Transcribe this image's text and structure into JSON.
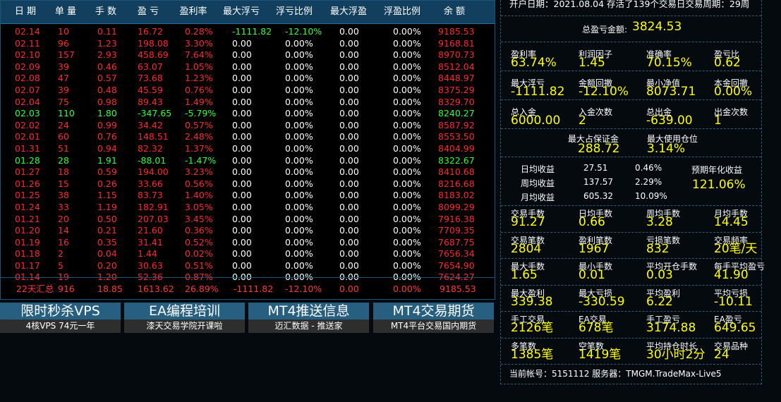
{
  "table": {
    "headers": [
      "日 期",
      "单 量",
      "手 数",
      "盈 亏",
      "盈利率",
      "最大浮亏",
      "浮亏比例",
      "最大浮盈",
      "浮盈比例",
      "余 额"
    ],
    "rows": [
      [
        "02.14",
        "10",
        "0.11",
        "16.72",
        "0.28%",
        "-1111.82",
        "-12.10%",
        "0.00",
        "0.00%",
        "9185.53"
      ],
      [
        "02.11",
        "96",
        "1.23",
        "198.08",
        "3.30%",
        "0.00",
        "0.00%",
        "0.00",
        "0.00%",
        "9168.81"
      ],
      [
        "02.10",
        "157",
        "2.93",
        "458.69",
        "7.64%",
        "0.00",
        "0.00%",
        "0.00",
        "0.00%",
        "8970.73"
      ],
      [
        "02.09",
        "39",
        "0.46",
        "63.07",
        "1.05%",
        "0.00",
        "0.00%",
        "0.00",
        "0.00%",
        "8512.04"
      ],
      [
        "02.08",
        "47",
        "0.57",
        "73.68",
        "1.23%",
        "0.00",
        "0.00%",
        "0.00",
        "0.00%",
        "8448.97"
      ],
      [
        "02.07",
        "39",
        "0.48",
        "45.59",
        "0.76%",
        "0.00",
        "0.00%",
        "0.00",
        "0.00%",
        "8375.29"
      ],
      [
        "02.04",
        "75",
        "0.98",
        "89.43",
        "1.49%",
        "0.00",
        "0.00%",
        "0.00",
        "0.00%",
        "8329.70"
      ],
      [
        "02.03",
        "110",
        "1.80",
        "-347.65",
        "-5.79%",
        "0.00",
        "0.00%",
        "0.00",
        "0.00%",
        "8240.27"
      ],
      [
        "02.02",
        "24",
        "0.99",
        "34.42",
        "0.57%",
        "0.00",
        "0.00%",
        "0.00",
        "0.00%",
        "8587.92"
      ],
      [
        "02.01",
        "60",
        "0.76",
        "148.51",
        "2.48%",
        "0.00",
        "0.00%",
        "0.00",
        "0.00%",
        "8553.50"
      ],
      [
        "01.31",
        "51",
        "0.94",
        "82.32",
        "1.37%",
        "0.00",
        "0.00%",
        "0.00",
        "0.00%",
        "8404.99"
      ],
      [
        "01.28",
        "28",
        "1.91",
        "-88.01",
        "-1.47%",
        "0.00",
        "0.00%",
        "0.00",
        "0.00%",
        "8322.67"
      ],
      [
        "01.27",
        "18",
        "0.59",
        "194.00",
        "3.23%",
        "0.00",
        "0.00%",
        "0.00",
        "0.00%",
        "8410.68"
      ],
      [
        "01.26",
        "15",
        "0.26",
        "33.66",
        "0.56%",
        "0.00",
        "0.00%",
        "0.00",
        "0.00%",
        "8216.68"
      ],
      [
        "01.25",
        "38",
        "1.15",
        "83.73",
        "1.40%",
        "0.00",
        "0.00%",
        "0.00",
        "0.00%",
        "8183.02"
      ],
      [
        "01.24",
        "33",
        "1.19",
        "182.91",
        "3.05%",
        "0.00",
        "0.00%",
        "0.00",
        "0.00%",
        "8099.29"
      ],
      [
        "01.21",
        "20",
        "0.50",
        "207.03",
        "3.45%",
        "0.00",
        "0.00%",
        "0.00",
        "0.00%",
        "7916.38"
      ],
      [
        "01.20",
        "14",
        "0.21",
        "21.60",
        "0.36%",
        "0.00",
        "0.00%",
        "0.00",
        "0.00%",
        "7709.35"
      ],
      [
        "01.19",
        "16",
        "0.35",
        "31.41",
        "0.52%",
        "0.00",
        "0.00%",
        "0.00",
        "0.00%",
        "7687.75"
      ],
      [
        "01.18",
        "2",
        "0.04",
        "1.44",
        "0.02%",
        "0.00",
        "0.00%",
        "0.00",
        "0.00%",
        "7656.34"
      ],
      [
        "01.17",
        "5",
        "0.20",
        "30.63",
        "0.51%",
        "0.00",
        "0.00%",
        "0.00",
        "0.00%",
        "7654.90"
      ],
      [
        "01.14",
        "19",
        "1.20",
        "52.36",
        "0.87%",
        "0.00",
        "0.00%",
        "0.00",
        "0.00%",
        "7624.27"
      ]
    ],
    "total": [
      "22天汇总",
      "916",
      "18.85",
      "1613.62",
      "26.89%",
      "-1111.82",
      "-12.10%",
      "0.00",
      "0.00%",
      "9185.53"
    ]
  },
  "colors": {
    "loss_row": "#33ff33",
    "profit_row": "#ff2a2a",
    "neutral": "#ffffff",
    "value": "#ffff00",
    "header_bg": "#123f5e"
  },
  "ads": [
    {
      "title": "限时秒杀VPS",
      "sub": "4核VPS  74元一年"
    },
    {
      "title": "EA编程培训",
      "sub": "漆天交易学院开课啦"
    },
    {
      "title": "MT4推送信息",
      "sub": "迈汇数据 - 推送家"
    },
    {
      "title": "MT4交易期货",
      "sub": "MT4平台交易国内期货"
    }
  ],
  "summary": {
    "open_info": "开户日期：2021.08.04 存活了139个交易日交易周期：29周",
    "total_profit_label": "总盈亏金额:",
    "total_profit": "3824.53",
    "grid1": [
      {
        "label": "盈利率",
        "value": "63.74%"
      },
      {
        "label": "利润因子",
        "value": "1.45"
      },
      {
        "label": "准确率",
        "value": "70.15%"
      },
      {
        "label": "盈亏比",
        "value": "0.62"
      },
      {
        "label": "最大浮亏",
        "value": "-1111.82"
      },
      {
        "label": "金额回撤",
        "value": "-12.10%"
      },
      {
        "label": "最小净值",
        "value": "8073.71"
      },
      {
        "label": "本金回撤",
        "value": "0.00%"
      },
      {
        "label": "总入金",
        "value": "6000.00"
      },
      {
        "label": "入金次数",
        "value": "2"
      },
      {
        "label": "总出金",
        "value": "-639.00"
      },
      {
        "label": "出金次数",
        "value": "1"
      }
    ],
    "margin": [
      {
        "label": "最大占保证金",
        "value": "288.72"
      },
      {
        "label": "最大使用仓位",
        "value": "3.14%"
      }
    ],
    "returns": [
      {
        "label": "日均收益",
        "amount": "27.51",
        "pct": "0.46%"
      },
      {
        "label": "周均收益",
        "amount": "137.57",
        "pct": "2.29%"
      },
      {
        "label": "月均收益",
        "amount": "605.32",
        "pct": "10.09%"
      }
    ],
    "annual_label": "预期年化收益",
    "annual_value": "121.06%",
    "grid2": [
      {
        "label": "交易手数",
        "value": "91.27"
      },
      {
        "label": "日均手数",
        "value": "0.66"
      },
      {
        "label": "周均手数",
        "value": "3.28"
      },
      {
        "label": "月均手数",
        "value": "14.45"
      },
      {
        "label": "交易笔数",
        "value": "2804"
      },
      {
        "label": "盈利笔数",
        "value": "1967"
      },
      {
        "label": "亏损笔数",
        "value": "832"
      },
      {
        "label": "交易频率",
        "value": "20笔/天"
      },
      {
        "label": "最大手数",
        "value": "1.65"
      },
      {
        "label": "最小手数",
        "value": "0.01"
      },
      {
        "label": "平均开仓手数",
        "value": "0.03"
      },
      {
        "label": "每手平均盈亏",
        "value": "41.90"
      },
      {
        "label": "最大盈利",
        "value": "339.38"
      },
      {
        "label": "最大亏损",
        "value": "-330.59"
      },
      {
        "label": "平均盈利",
        "value": "6.22"
      },
      {
        "label": "平均亏损",
        "value": "-10.11"
      },
      {
        "label": "手工交易",
        "value": "2126笔"
      },
      {
        "label": "EA交易",
        "value": "678笔"
      },
      {
        "label": "手工盈亏",
        "value": "3174.88"
      },
      {
        "label": "EA盈亏",
        "value": "649.65"
      },
      {
        "label": "多笔数",
        "value": "1385笔"
      },
      {
        "label": "空笔数",
        "value": "1419笔"
      },
      {
        "label": "平均持仓时长",
        "value": "30小时2分"
      },
      {
        "label": "交易品种",
        "value": " 24"
      }
    ],
    "account": "当前帐号：5151112 服务器：TMGM.TradeMax-Live5"
  }
}
